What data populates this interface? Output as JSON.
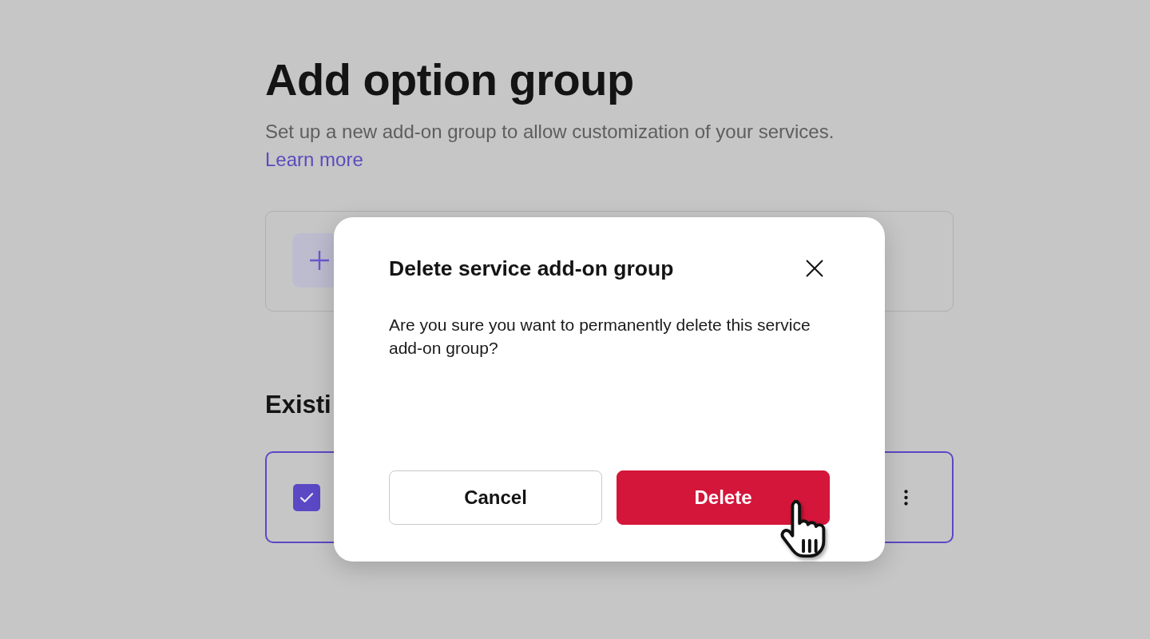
{
  "page": {
    "title": "Add option group",
    "subtitle": "Set up a new add-on group to allow customization of your services.",
    "link": "Learn more"
  },
  "existing_section": {
    "heading": "Existi",
    "groups": [
      {
        "selected": true,
        "checked": true
      }
    ]
  },
  "dialog": {
    "title": "Delete service add-on group",
    "message": "Are you sure you want to permanently delete this service add-on group?",
    "buttons": [
      {
        "label": "Cancel",
        "kind": "secondary"
      },
      {
        "label": "Delete",
        "kind": "danger"
      }
    ]
  }
}
